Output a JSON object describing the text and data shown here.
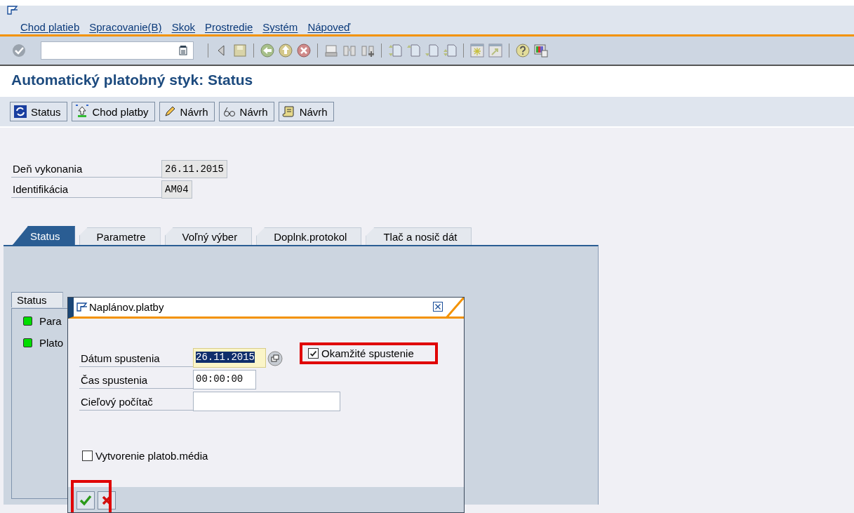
{
  "menu": [
    {
      "label": "Chod platieb"
    },
    {
      "label": "Spracovanie(B)"
    },
    {
      "label": "Skok"
    },
    {
      "label": "Prostredie"
    },
    {
      "label": "Systém"
    },
    {
      "label": "Nápoveď"
    }
  ],
  "toolbar": [
    {
      "kind": "enter"
    },
    {
      "kind": "command"
    },
    {
      "kind": "sep"
    },
    {
      "kind": "back-tri"
    },
    {
      "kind": "save"
    },
    {
      "kind": "sep"
    },
    {
      "kind": "back"
    },
    {
      "kind": "exit"
    },
    {
      "kind": "cancel"
    },
    {
      "kind": "sep"
    },
    {
      "kind": "print"
    },
    {
      "kind": "find"
    },
    {
      "kind": "find-next"
    },
    {
      "kind": "sep"
    },
    {
      "kind": "first"
    },
    {
      "kind": "prev"
    },
    {
      "kind": "next"
    },
    {
      "kind": "last"
    },
    {
      "kind": "sep"
    },
    {
      "kind": "new-session"
    },
    {
      "kind": "shortcut"
    },
    {
      "kind": "sep"
    },
    {
      "kind": "help"
    },
    {
      "kind": "layout"
    }
  ],
  "title": "Automatický platobný styk: Status",
  "app_toolbar": [
    {
      "kind": "refresh",
      "label": "Status"
    },
    {
      "kind": "run",
      "label": "Chod platby"
    },
    {
      "kind": "pencil",
      "label": "Návrh"
    },
    {
      "kind": "glasses",
      "label": "Návrh"
    },
    {
      "kind": "scroll",
      "label": "Návrh"
    }
  ],
  "fields": [
    {
      "label": "Deň vykonania",
      "value": "26.11.2015"
    },
    {
      "label": "Identifikácia",
      "value": "AM04"
    }
  ],
  "tabs": [
    {
      "label": "Status",
      "selected": true
    },
    {
      "label": "Parametre",
      "selected": false
    },
    {
      "label": "Voľný výber",
      "selected": false
    },
    {
      "label": "Doplnk.protokol",
      "selected": false
    },
    {
      "label": "Tlač a nosič dát",
      "selected": false
    }
  ],
  "subtab": {
    "label": "Status"
  },
  "status_items": [
    {
      "text": "Para",
      "color": "#00dd00"
    },
    {
      "text": "Plato",
      "color": "#00dd00"
    }
  ],
  "dialog": {
    "title": "Naplánov.platby",
    "fields": [
      {
        "label": "Dátum spustenia",
        "value": "26.11.2015",
        "kind": "date",
        "text_selected": true
      },
      {
        "label": "Čas spustenia",
        "value": "00:00:00",
        "kind": "time",
        "text_selected": false
      },
      {
        "label": "Cieľový počítač",
        "kind": "wide"
      }
    ],
    "checkboxes": [
      {
        "label": "Okamžité spustenie",
        "checked": true,
        "highlighted": true
      },
      {
        "label": "Vytvorenie platob.média",
        "checked": false,
        "highlighted": false
      }
    ],
    "buttons": [
      {
        "kind": "confirm",
        "highlighted": true
      },
      {
        "kind": "cancel",
        "highlighted": false
      }
    ]
  }
}
